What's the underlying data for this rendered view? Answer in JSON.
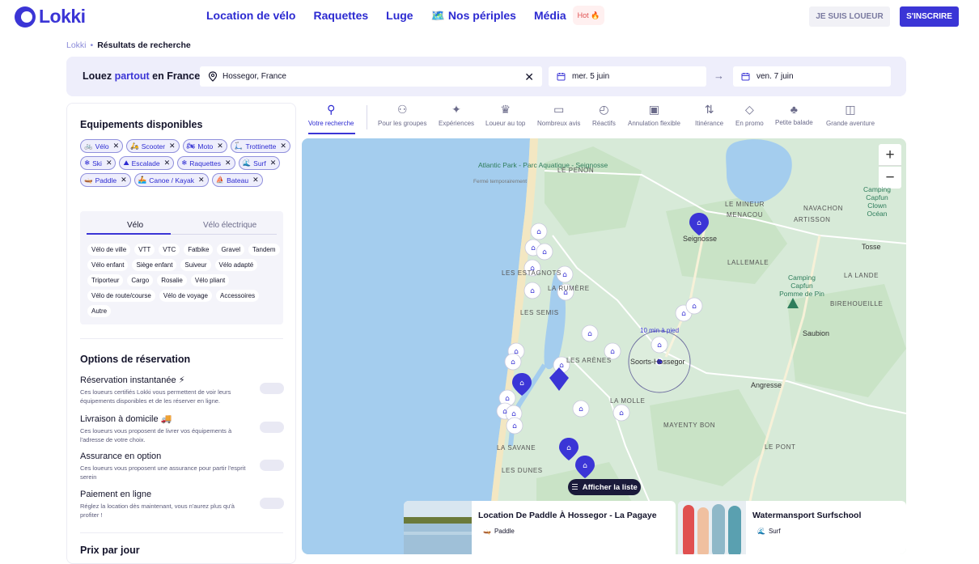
{
  "header": {
    "logo": "Lokki",
    "nav": [
      "Location de vélo",
      "Raquettes",
      "Luge",
      "🗺️ Nos périples",
      "Média"
    ],
    "hot_badge": "Hot 🔥",
    "btn_loueur": "JE SUIS LOUEUR",
    "btn_inscrire": "S'INSCRIRE"
  },
  "breadcrumb": {
    "root": "Lokki",
    "sep": "•",
    "current": "Résultats de recherche"
  },
  "search": {
    "title_pre": "Louez ",
    "title_accent": "partout",
    "title_post": " en France",
    "location": "Hossegor, France",
    "date_start": "mer. 5 juin",
    "date_end": "ven. 7 juin"
  },
  "sidebar": {
    "equip_title": "Equipements disponibles",
    "equipment": [
      {
        "label": "Vélo",
        "icon": "bike-icon",
        "glyph": "🚲"
      },
      {
        "label": "Scooter",
        "icon": "scooter-icon",
        "glyph": "🛵"
      },
      {
        "label": "Moto",
        "icon": "moto-icon",
        "glyph": "🏍"
      },
      {
        "label": "Trottinette",
        "icon": "scooter-kick-icon",
        "glyph": "🛴"
      },
      {
        "label": "Ski",
        "icon": "snowflake-icon",
        "glyph": "❄"
      },
      {
        "label": "Escalade",
        "icon": "mountain-icon",
        "glyph": "⛰"
      },
      {
        "label": "Raquettes",
        "icon": "snowflake-icon",
        "glyph": "❄"
      },
      {
        "label": "Surf",
        "icon": "wave-icon",
        "glyph": "🌊"
      },
      {
        "label": "Paddle",
        "icon": "paddle-icon",
        "glyph": "🛶"
      },
      {
        "label": "Canoe / Kayak",
        "icon": "kayak-icon",
        "glyph": "🚣"
      },
      {
        "label": "Bateau",
        "icon": "boat-icon",
        "glyph": "⛵"
      }
    ],
    "tabs": [
      "Vélo",
      "Vélo électrique"
    ],
    "bike_types": [
      "Vélo de ville",
      "VTT",
      "VTC",
      "Fatbike",
      "Gravel",
      "Tandem",
      "Vélo enfant",
      "Siège enfant",
      "Suiveur",
      "Vélo adapté",
      "Triporteur",
      "Cargo",
      "Rosalie",
      "Vélo pliant",
      "Vélo de route/course",
      "Vélo de voyage",
      "Accessoires",
      "Autre"
    ],
    "options_title": "Options de réservation",
    "options": [
      {
        "title": "Réservation instantanée ⚡",
        "desc": "Ces loueurs certifiés Lokki vous permettent de voir leurs équipements disponibles et de les réserver en ligne."
      },
      {
        "title": "Livraison à domicile 🚚",
        "desc": "Ces loueurs vous proposent de livrer vos équipements à l'adresse de votre choix."
      },
      {
        "title": "Assurance en option",
        "desc": "Ces loueurs vous proposent une assurance pour partir l'esprit serein"
      },
      {
        "title": "Paiement en ligne",
        "desc": "Réglez la location dès maintenant, vous n'aurez plus qu'à profiter !"
      }
    ],
    "price_title": "Prix par jour"
  },
  "categories": [
    {
      "label": "Votre recherche",
      "icon": "search-person-icon",
      "glyph": "⚲"
    },
    {
      "label": "Pour les groupes",
      "icon": "group-icon",
      "glyph": "👥"
    },
    {
      "label": "Expériences",
      "icon": "sparkle-icon",
      "glyph": "✦"
    },
    {
      "label": "Loueur au top",
      "icon": "crown-icon",
      "glyph": "♛"
    },
    {
      "label": "Nombreux avis",
      "icon": "chat-icon",
      "glyph": "🗨"
    },
    {
      "label": "Réactifs",
      "icon": "stopwatch-icon",
      "glyph": "⏱"
    },
    {
      "label": "Annulation flexible",
      "icon": "wallet-icon",
      "glyph": "▣"
    },
    {
      "label": "Itinérance",
      "icon": "route-icon",
      "glyph": "⇅"
    },
    {
      "label": "En promo",
      "icon": "tag-icon",
      "glyph": "🏷"
    },
    {
      "label": "Petite balade",
      "icon": "tree-icon",
      "glyph": "♣"
    },
    {
      "label": "Grande aventure",
      "icon": "map-icon",
      "glyph": "🗺"
    }
  ],
  "map": {
    "labels": {
      "atlantic": "Atlantic Park - Parc\nAquatique - Seignosse",
      "atlantic_sub": "Fermé temporairement",
      "le_penon": "LE PENON",
      "le_mineur": "LE MINEUR",
      "menacou": "MENACOU",
      "navachon": "NAVACHON",
      "artisson": "ARTISSON",
      "camping1": "Camping\nCapfun\nClown Océan",
      "seignosse": "Seignosse",
      "tosse": "Tosse",
      "lallemale": "LALLEMALE",
      "les_estagnots": "LES ESTAGNOTS",
      "la_rumere": "LA RUMÈRE",
      "les_semis": "LES SEMIS",
      "camping2": "Camping\nCapfun\nPomme de Pin",
      "la_lande": "LA LANDE",
      "birehoueille": "BIREHOUEILLE",
      "saubion": "Saubion",
      "les_arenes": "LES ARÈNES",
      "soorts": "Soorts-Hossegor",
      "angresse": "Angresse",
      "la_molle": "LA MOLLE",
      "mayenty_bon": "MAYENTY BON",
      "la_savane": "LA SAVANE",
      "les_dunes": "LES DUNES",
      "le_pont": "LE PONT"
    },
    "walk_label": "10 min à pied",
    "show_list": "Afficher la liste"
  },
  "cards": [
    {
      "title": "Location De Paddle À Hossegor - La Pagaye",
      "category": "Paddle",
      "glyph": "🛶"
    },
    {
      "title": "Watermansport Surfschool",
      "category": "Surf",
      "glyph": "🌊"
    }
  ],
  "colors": {
    "brand": "#3b35d6",
    "map_land": "#d7ead8",
    "map_water": "#a4cdee",
    "map_sand": "#f3e7c2"
  }
}
